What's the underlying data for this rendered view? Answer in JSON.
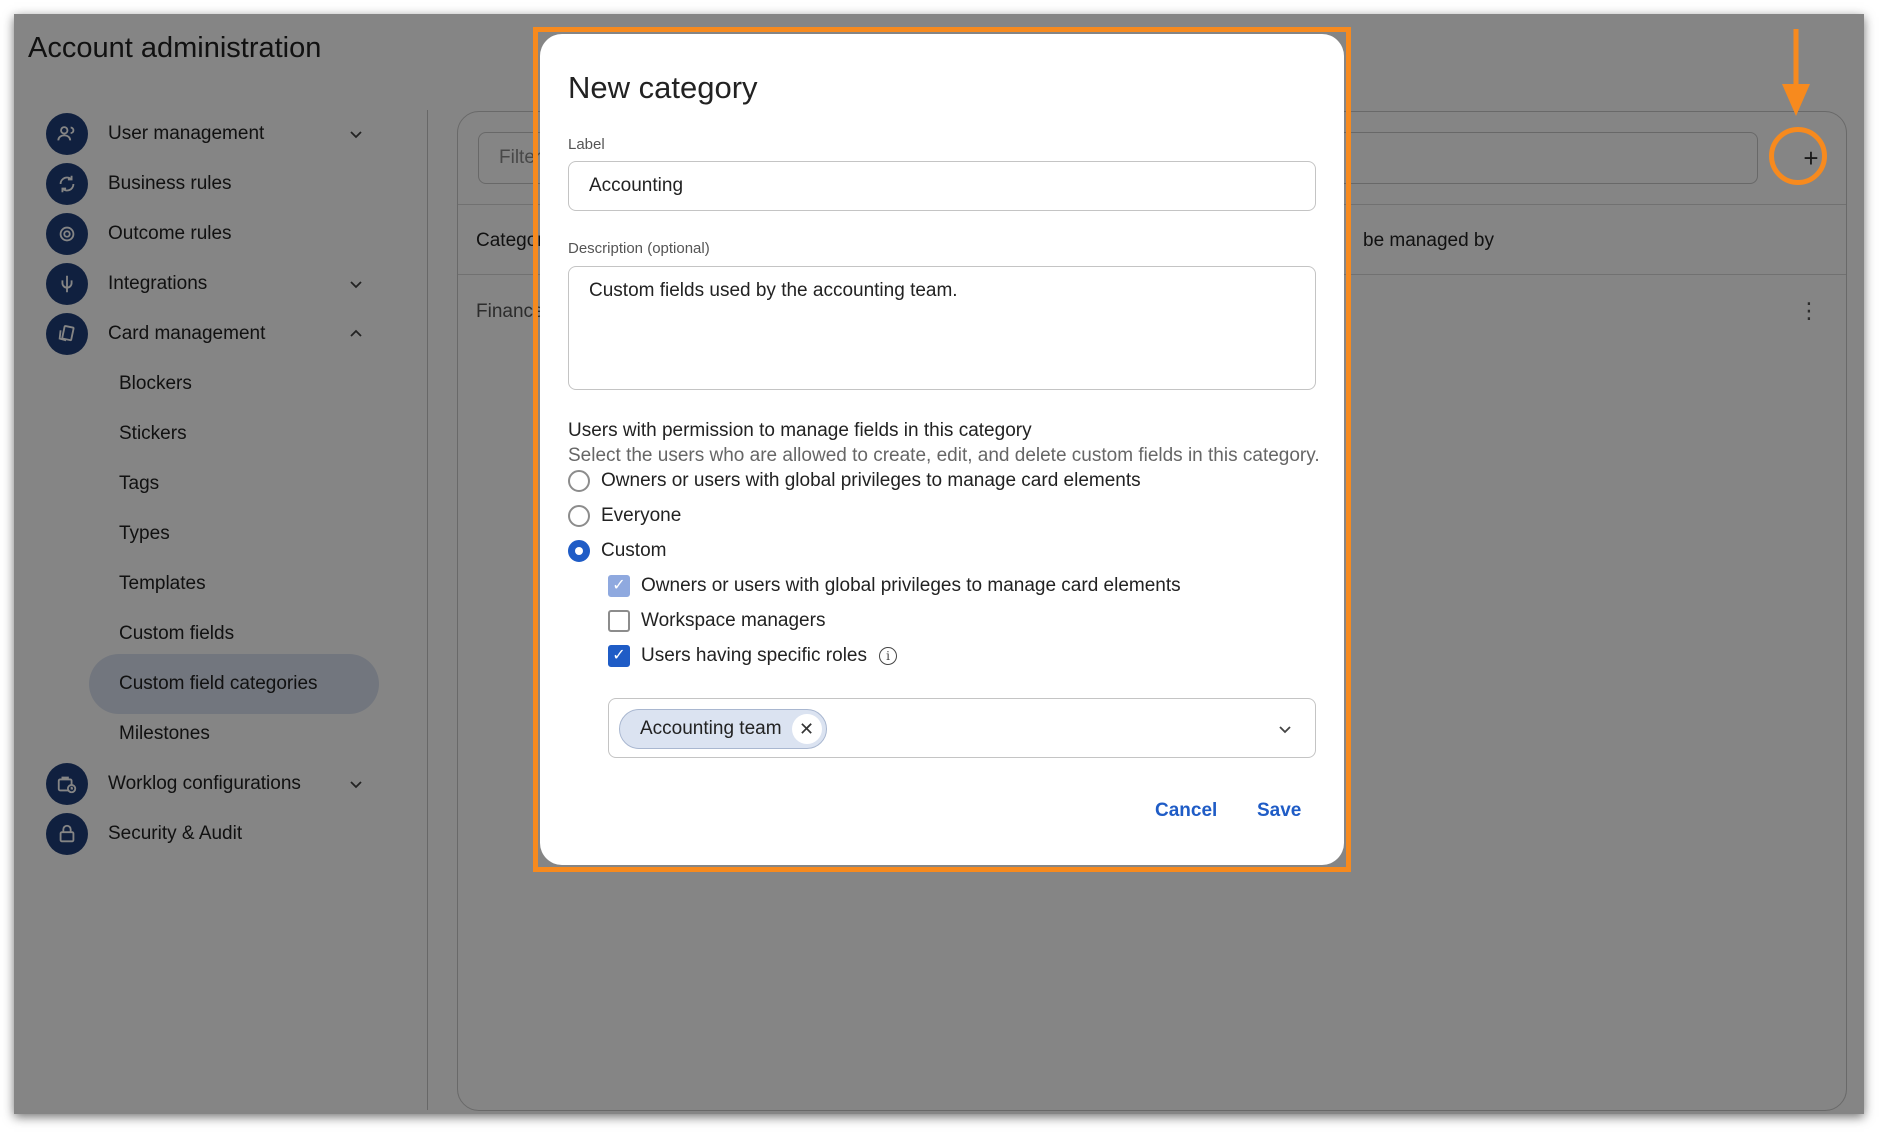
{
  "app": {
    "title": "Account administration"
  },
  "sidebar": {
    "items": [
      {
        "label": "User management",
        "icon": "users-icon",
        "expandable": "down"
      },
      {
        "label": "Business rules",
        "icon": "refresh-icon",
        "expandable": ""
      },
      {
        "label": "Outcome rules",
        "icon": "target-icon",
        "expandable": ""
      },
      {
        "label": "Integrations",
        "icon": "plug-icon",
        "expandable": "down"
      },
      {
        "label": "Card management",
        "icon": "cards-icon",
        "expandable": "up"
      },
      {
        "label": "Worklog configurations",
        "icon": "briefcase-clock-icon",
        "expandable": "down"
      },
      {
        "label": "Security & Audit",
        "icon": "lock-icon",
        "expandable": ""
      }
    ],
    "card_management_children": [
      "Blockers",
      "Stickers",
      "Tags",
      "Types",
      "Templates",
      "Custom fields",
      "Custom field categories",
      "Milestones"
    ],
    "active_child": "Custom field categories"
  },
  "main": {
    "filter_placeholder": "Filter",
    "columns": {
      "category": "Categor",
      "managed_by": "be managed by"
    },
    "rows": [
      {
        "category": "Finance"
      }
    ]
  },
  "modal": {
    "title": "New category",
    "label_field": {
      "label": "Label",
      "value": "Accounting"
    },
    "description_field": {
      "label": "Description (optional)",
      "value": "Custom fields used by the accounting team."
    },
    "permissions": {
      "title": "Users with permission to manage fields in this category",
      "subtitle": "Select the users who are allowed to create, edit, and delete custom fields in this category.",
      "options": [
        {
          "label": "Owners or users with global privileges to manage card elements",
          "selected": false
        },
        {
          "label": "Everyone",
          "selected": false
        },
        {
          "label": "Custom",
          "selected": true
        }
      ],
      "custom_checks": [
        {
          "label": "Owners or users with global privileges to manage card elements",
          "checked": true,
          "disabled": true
        },
        {
          "label": "Workspace managers",
          "checked": false,
          "disabled": false
        },
        {
          "label": "Users having specific roles",
          "checked": true,
          "disabled": false
        }
      ],
      "roles": [
        "Accounting team"
      ]
    },
    "cancel": "Cancel",
    "save": "Save"
  },
  "colors": {
    "accent": "#1f5cc6",
    "annotation": "#f78a1e",
    "nav_icon_bg": "#1f3f7a"
  }
}
